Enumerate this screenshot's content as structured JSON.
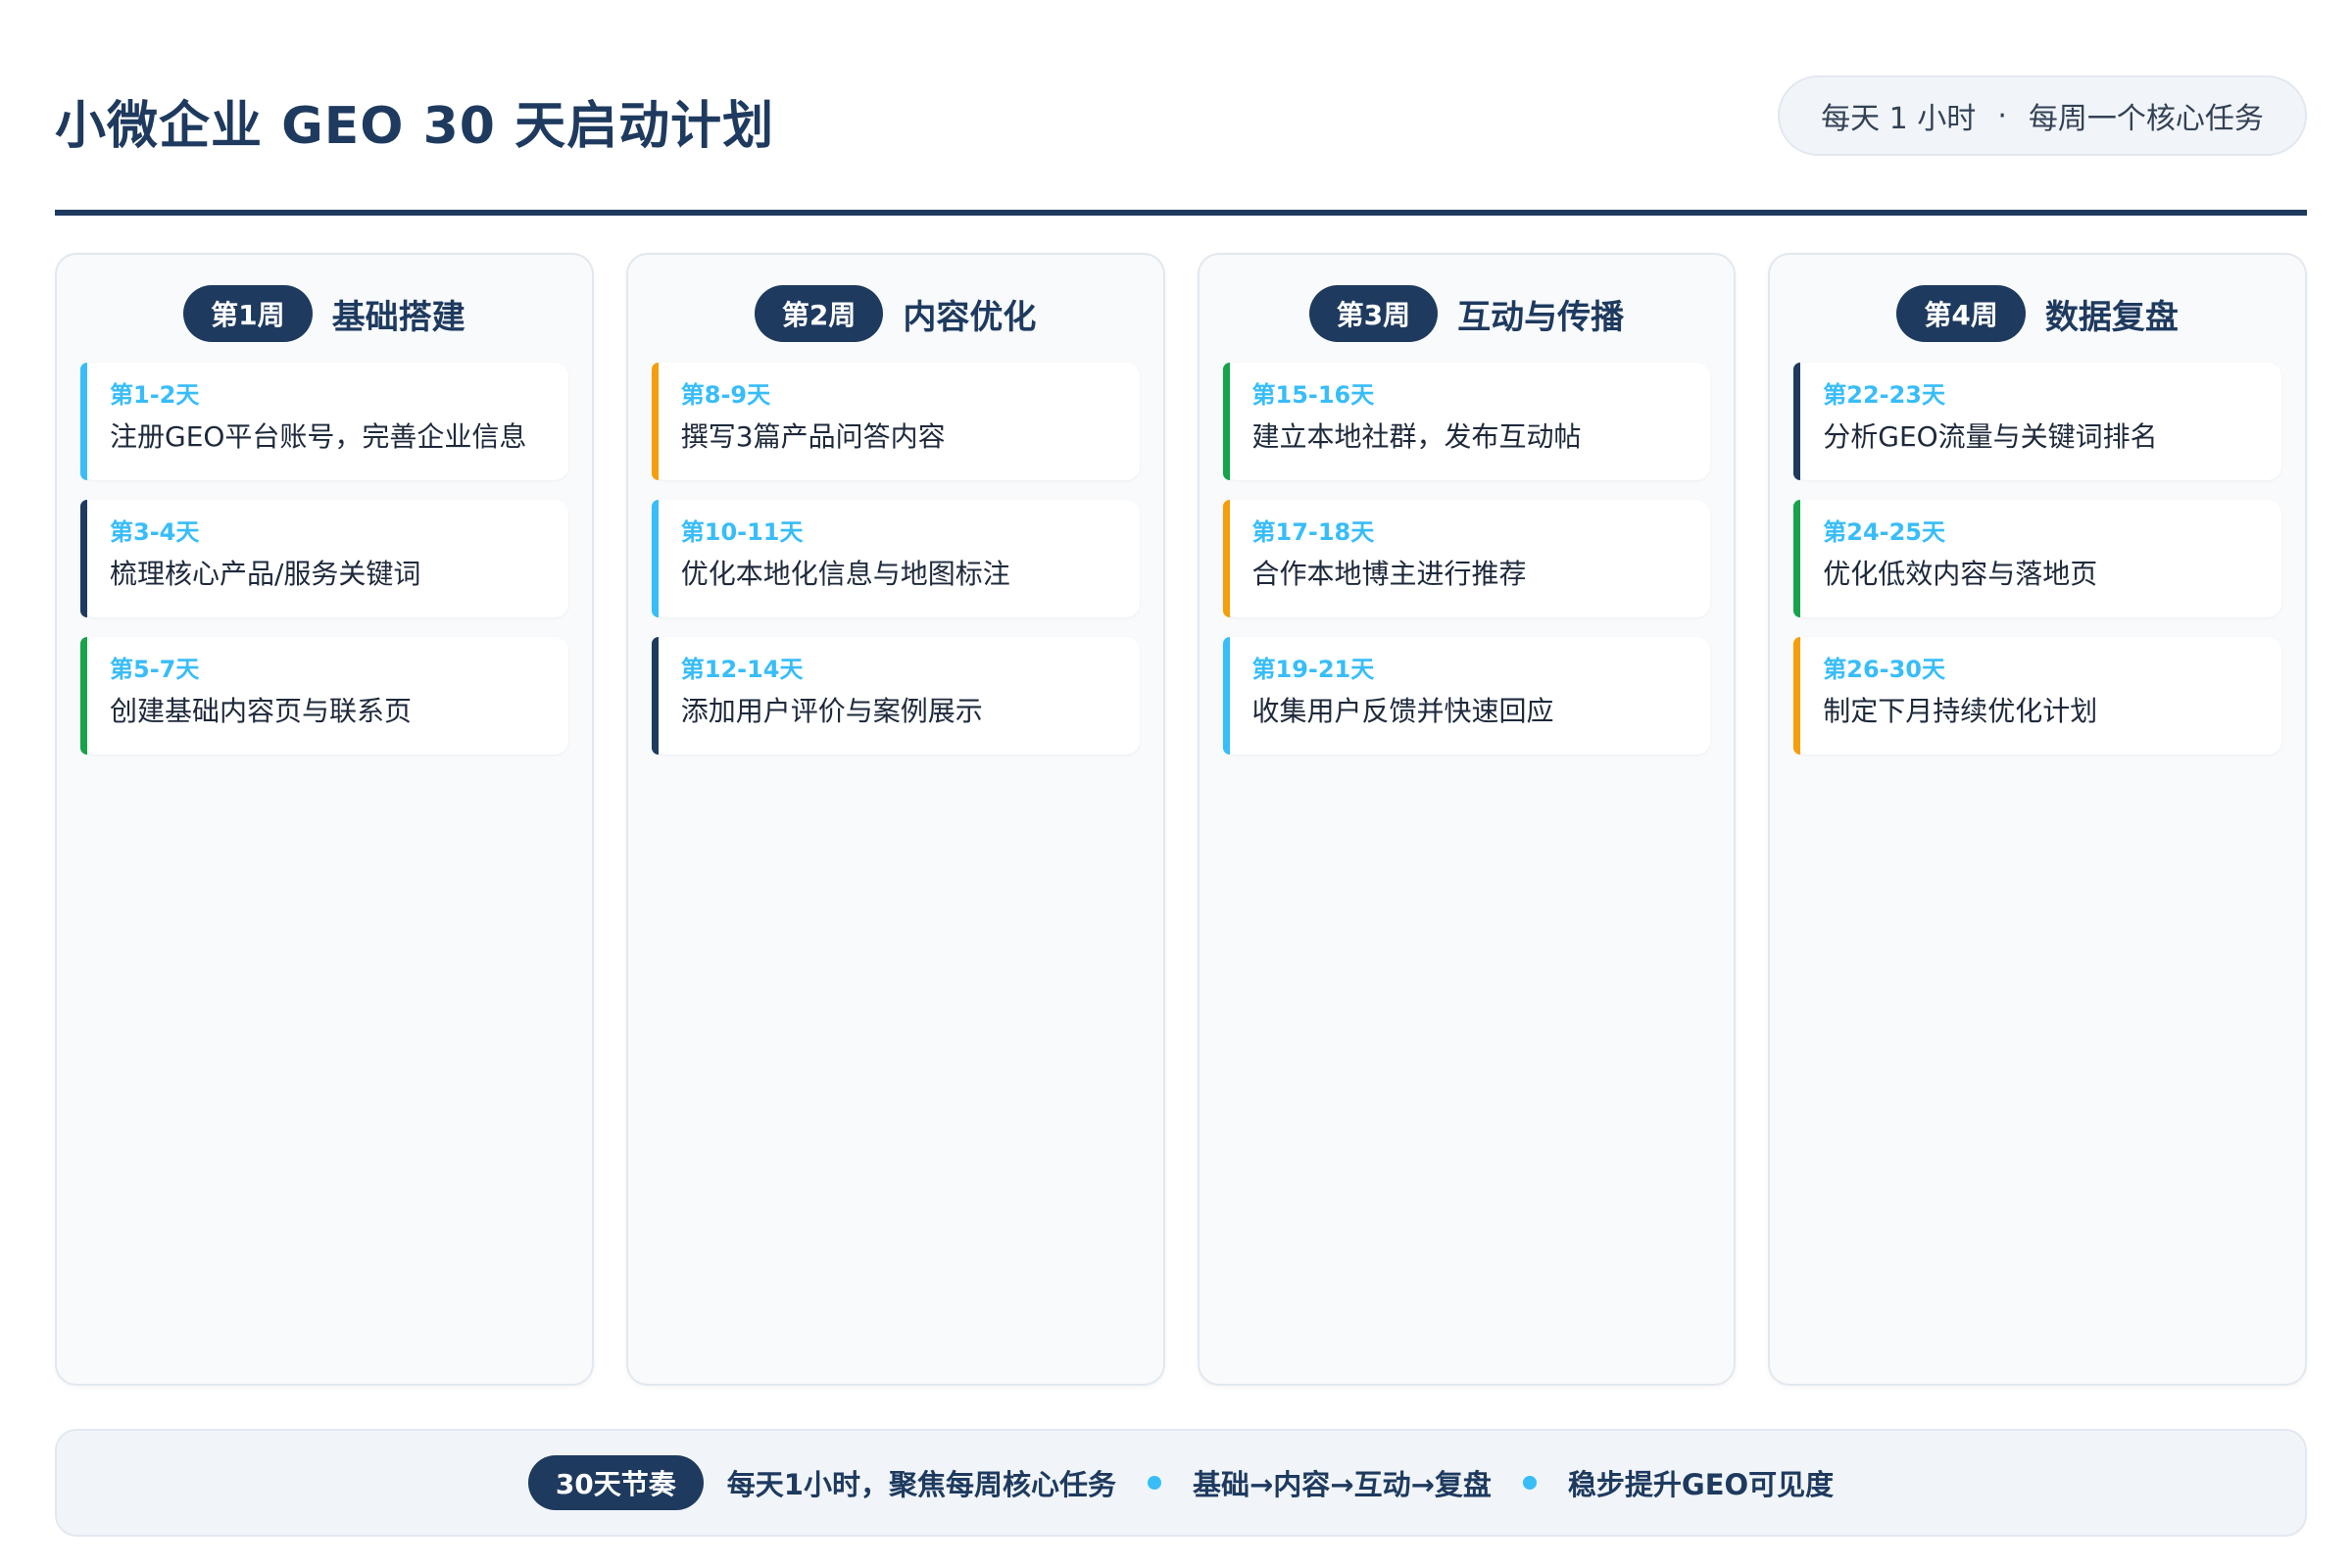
{
  "header": {
    "title": "小微企业 GEO 30 天启动计划",
    "pill_part1": "每天 1 小时",
    "pill_separator": "·",
    "pill_part2": "每周一个核心任务"
  },
  "colors": {
    "navy": "#1e3a5f",
    "sky": "#38bdf8",
    "orange": "#f59e0b",
    "green": "#16a34a"
  },
  "weeks": [
    {
      "badge": "第1周",
      "title": "基础搭建",
      "tasks": [
        {
          "days": "第1-2天",
          "text": "注册GEO平台账号，完善企业信息",
          "accent": "#38bdf8"
        },
        {
          "days": "第3-4天",
          "text": "梳理核心产品/服务关键词",
          "accent": "#1e3a5f"
        },
        {
          "days": "第5-7天",
          "text": "创建基础内容页与联系页",
          "accent": "#16a34a"
        }
      ]
    },
    {
      "badge": "第2周",
      "title": "内容优化",
      "tasks": [
        {
          "days": "第8-9天",
          "text": "撰写3篇产品问答内容",
          "accent": "#f59e0b"
        },
        {
          "days": "第10-11天",
          "text": "优化本地化信息与地图标注",
          "accent": "#38bdf8"
        },
        {
          "days": "第12-14天",
          "text": "添加用户评价与案例展示",
          "accent": "#1e3a5f"
        }
      ]
    },
    {
      "badge": "第3周",
      "title": "互动与传播",
      "tasks": [
        {
          "days": "第15-16天",
          "text": "建立本地社群，发布互动帖",
          "accent": "#16a34a"
        },
        {
          "days": "第17-18天",
          "text": "合作本地博主进行推荐",
          "accent": "#f59e0b"
        },
        {
          "days": "第19-21天",
          "text": "收集用户反馈并快速回应",
          "accent": "#38bdf8"
        }
      ]
    },
    {
      "badge": "第4周",
      "title": "数据复盘",
      "tasks": [
        {
          "days": "第22-23天",
          "text": "分析GEO流量与关键词排名",
          "accent": "#1e3a5f"
        },
        {
          "days": "第24-25天",
          "text": "优化低效内容与落地页",
          "accent": "#16a34a"
        },
        {
          "days": "第26-30天",
          "text": "制定下月持续优化计划",
          "accent": "#f59e0b"
        }
      ]
    }
  ],
  "footer": {
    "badge": "30天节奏",
    "segments": [
      "每天1小时，聚焦每周核心任务",
      "基础→内容→互动→复盘",
      "稳步提升GEO可见度"
    ]
  }
}
